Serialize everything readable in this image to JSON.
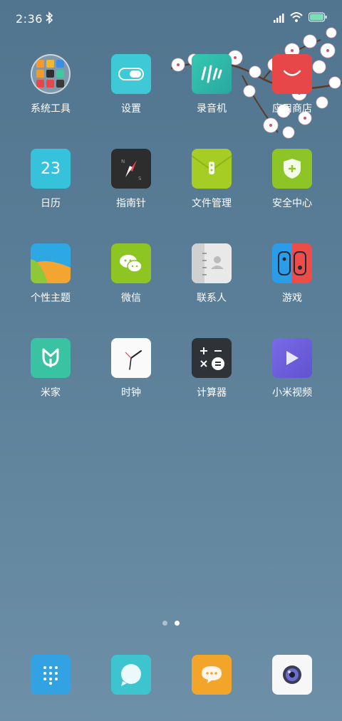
{
  "status": {
    "time": "2:36"
  },
  "apps": [
    {
      "label": "系统工具",
      "icon": "tools-folder-icon"
    },
    {
      "label": "设置",
      "icon": "settings-toggle-icon"
    },
    {
      "label": "录音机",
      "icon": "recorder-icon"
    },
    {
      "label": "应用商店",
      "icon": "app-store-icon"
    },
    {
      "label": "日历",
      "icon": "calendar-icon",
      "day": "23"
    },
    {
      "label": "指南针",
      "icon": "compass-icon"
    },
    {
      "label": "文件管理",
      "icon": "file-manager-icon"
    },
    {
      "label": "安全中心",
      "icon": "security-shield-icon"
    },
    {
      "label": "个性主题",
      "icon": "themes-icon"
    },
    {
      "label": "微信",
      "icon": "wechat-icon"
    },
    {
      "label": "联系人",
      "icon": "contacts-icon"
    },
    {
      "label": "游戏",
      "icon": "games-icon"
    },
    {
      "label": "米家",
      "icon": "mijia-icon"
    },
    {
      "label": "时钟",
      "icon": "clock-icon"
    },
    {
      "label": "计算器",
      "icon": "calculator-icon"
    },
    {
      "label": "小米视频",
      "icon": "video-play-icon"
    }
  ],
  "dock": [
    {
      "icon": "dialer-icon"
    },
    {
      "icon": "messaging-icon"
    },
    {
      "icon": "chat-bubble-icon"
    },
    {
      "icon": "camera-icon"
    }
  ],
  "pager": {
    "pages": 2,
    "current": 2
  },
  "colors": {
    "settings": "#3ec9d6",
    "recorder": "#2fc3a3",
    "store": "#e8474a",
    "calendar": "#37c2db",
    "compass": "#2d2d2d",
    "files": "#a5cd24",
    "security": "#8dc527",
    "wechat": "#8dc523",
    "games_left": "#2b9de8",
    "games_right": "#ee4c49",
    "mijia": "#39c3a3",
    "calculator": "#2f3236",
    "video": "#6b5fd9"
  }
}
